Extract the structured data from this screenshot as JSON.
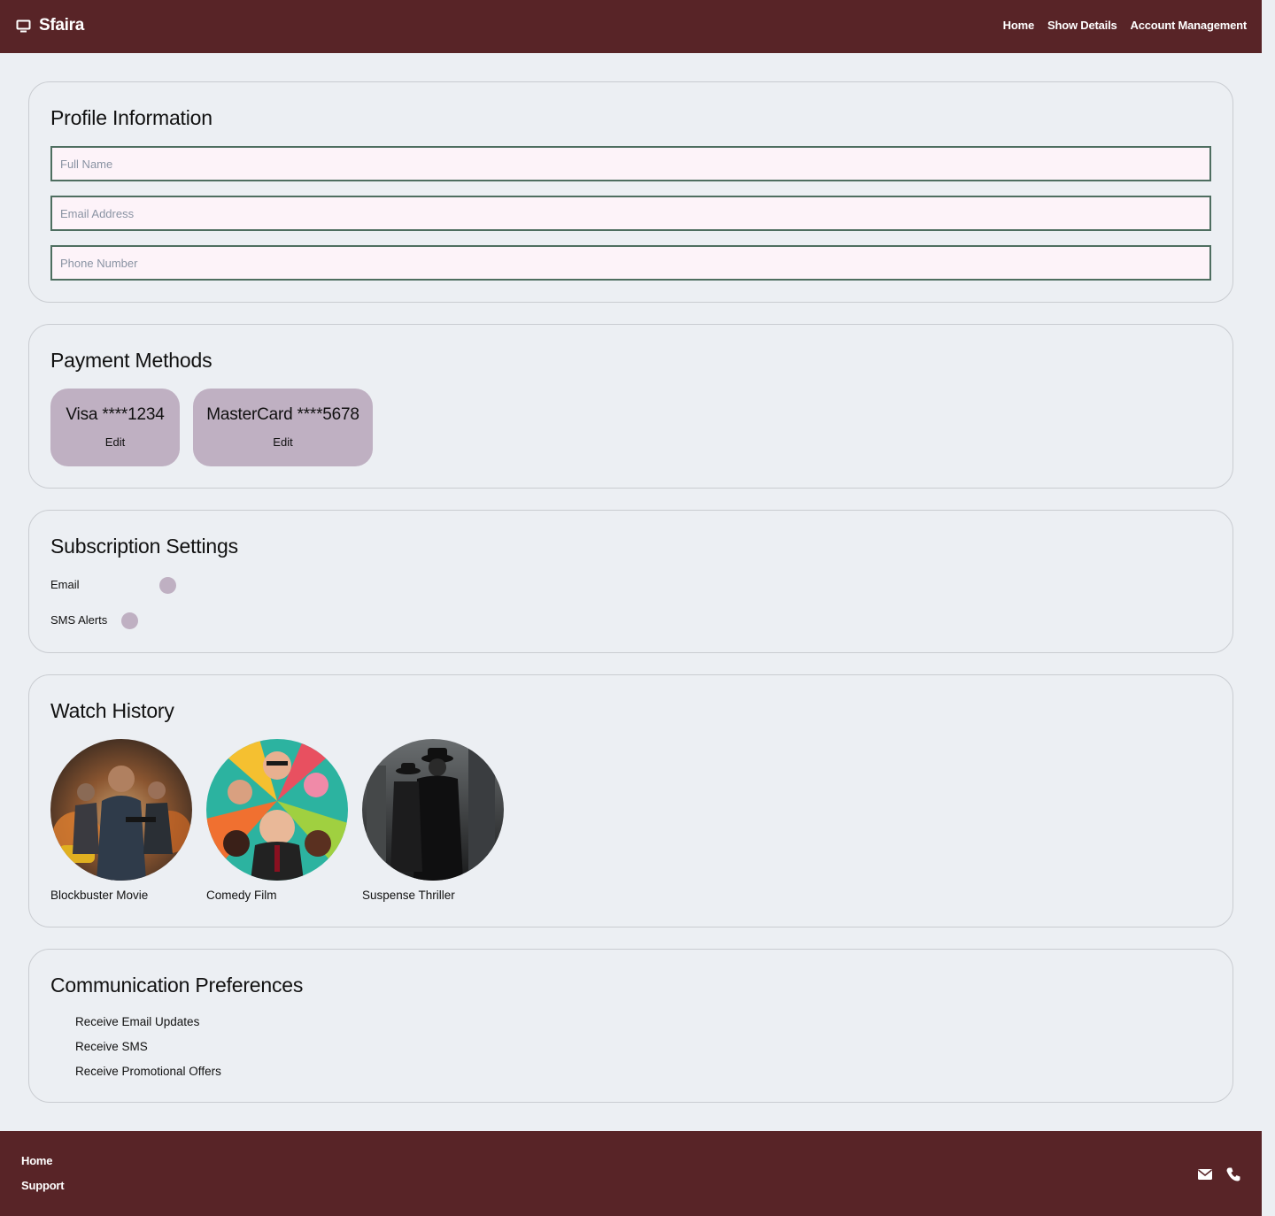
{
  "header": {
    "brand": "Sfaira",
    "nav": [
      "Home",
      "Show Details",
      "Account Management"
    ]
  },
  "profile": {
    "title": "Profile Information",
    "fields": [
      {
        "placeholder": "Full Name",
        "value": ""
      },
      {
        "placeholder": "Email Address",
        "value": ""
      },
      {
        "placeholder": "Phone Number",
        "value": ""
      }
    ]
  },
  "payment": {
    "title": "Payment Methods",
    "cards": [
      {
        "name": "Visa ****1234",
        "action": "Edit"
      },
      {
        "name": "MasterCard ****5678",
        "action": "Edit"
      }
    ]
  },
  "subscription": {
    "title": "Subscription Settings",
    "toggles": [
      {
        "label": "Email"
      },
      {
        "label": "SMS Alerts"
      }
    ]
  },
  "history": {
    "title": "Watch History",
    "items": [
      {
        "title": "Blockbuster Movie",
        "icon": "action-poster"
      },
      {
        "title": "Comedy Film",
        "icon": "comedy-poster"
      },
      {
        "title": "Suspense Thriller",
        "icon": "noir-poster"
      }
    ]
  },
  "communication": {
    "title": "Communication Preferences",
    "options": [
      "Receive Email Updates",
      "Receive SMS",
      "Receive Promotional Offers"
    ]
  },
  "footer": {
    "links": [
      "Home",
      "Support"
    ],
    "icons": [
      "envelope-icon",
      "phone-icon"
    ]
  },
  "colors": {
    "brand": "#582427",
    "accent": "#bfb0c2",
    "field_border": "#4e6e60",
    "field_bg": "#fdf3f9",
    "page_bg": "#eceff3"
  }
}
